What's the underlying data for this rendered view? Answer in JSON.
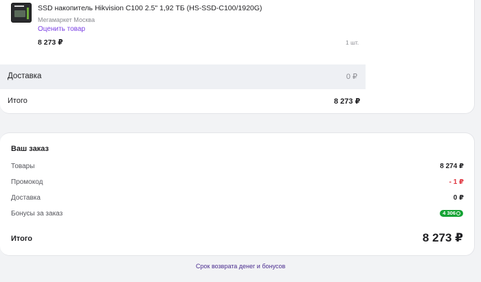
{
  "product": {
    "title": "SSD накопитель Hikvision C100 2.5\" 1,92 ТБ (HS-SSD-C100/1920G)",
    "seller": "Мегамаркет Москва",
    "rate_label": "Оценить товар",
    "price": "8 273 ₽",
    "quantity": "1 шт."
  },
  "cart": {
    "delivery_label": "Доставка",
    "delivery_value": "0 ₽",
    "total_label": "Итого",
    "total_value": "8 273 ₽"
  },
  "summary": {
    "title": "Ваш заказ",
    "rows": [
      {
        "label": "Товары",
        "value": "8 274 ₽"
      },
      {
        "label": "Промокод",
        "value": "- 1 ₽"
      },
      {
        "label": "Доставка",
        "value": "0 ₽"
      },
      {
        "label": "Бонусы за заказ",
        "value": "4 306"
      }
    ],
    "total_label": "Итого",
    "total_value": "8 273 ₽"
  },
  "footer": {
    "link": "Срок возврата денег и бонусов"
  },
  "colors": {
    "accent": "#7b3fe4",
    "negative": "#e0353f",
    "bonus": "#15a334"
  },
  "icons": {
    "product_image": "ssd-drive-image",
    "bonus": "bonus-coin-icon"
  }
}
